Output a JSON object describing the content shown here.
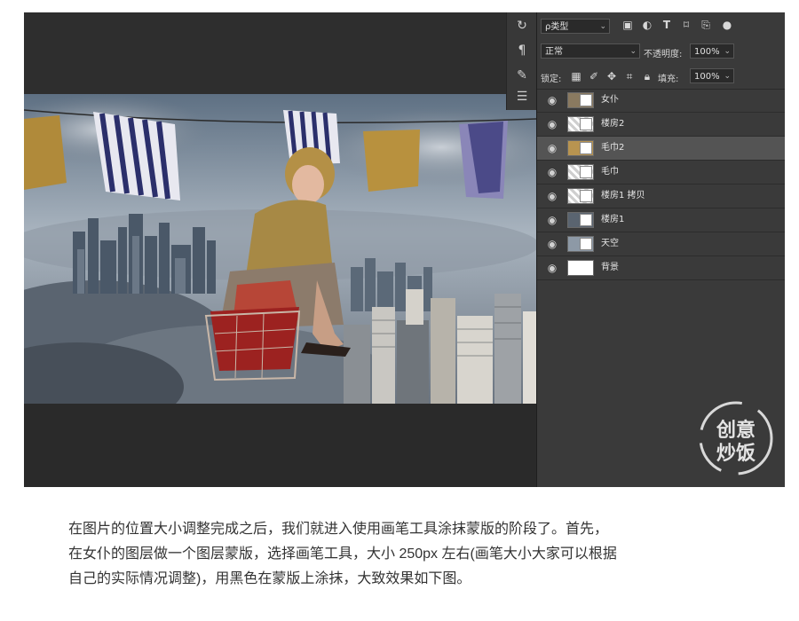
{
  "layers_panel": {
    "filter": {
      "label": "ρ类型",
      "icons": [
        "image-filter-icon",
        "adjustment-filter-icon",
        "type-filter-icon",
        "shape-filter-icon",
        "smart-object-filter-icon",
        "toggle-filter-icon"
      ]
    },
    "blend_mode": "正常",
    "opacity_label": "不透明度:",
    "opacity_value": "100%",
    "lock_label": "锁定:",
    "fill_label": "填充:",
    "fill_value": "100%",
    "layers": [
      {
        "name": "女仆",
        "visible": true,
        "selected": false,
        "has_mask": true
      },
      {
        "name": "楼房2",
        "visible": true,
        "selected": false,
        "has_mask": true
      },
      {
        "name": "毛巾2",
        "visible": true,
        "selected": true,
        "has_mask": true
      },
      {
        "name": "毛巾",
        "visible": true,
        "selected": false,
        "has_mask": true
      },
      {
        "name": "楼房1 拷贝",
        "visible": true,
        "selected": false,
        "has_mask": true
      },
      {
        "name": "楼房1",
        "visible": true,
        "selected": false,
        "has_mask": true
      },
      {
        "name": "天空",
        "visible": true,
        "selected": false,
        "has_mask": true
      },
      {
        "name": "背景",
        "visible": true,
        "selected": false,
        "has_mask": false
      }
    ]
  },
  "tool_icons": [
    "history-icon",
    "paragraph-icon",
    "brush-preset-icon",
    "properties-icon"
  ],
  "watermark": "创意炒饭",
  "caption": {
    "line1": "在图片的位置大小调整完成之后，我们就进入使用画笔工具涂抹蒙版的阶段了。首先，",
    "line2": "在女仆的图层做一个图层蒙版，选择画笔工具，大小 250px 左右(画笔大小大家可以根据",
    "line3": "自己的实际情况调整)，用黑色在蒙版上涂抹，大致效果如下图。"
  },
  "colors": {
    "panel_bg": "#3a3a3a",
    "selected_layer": "#545454",
    "canvas_bg": "#2b2b2b"
  }
}
